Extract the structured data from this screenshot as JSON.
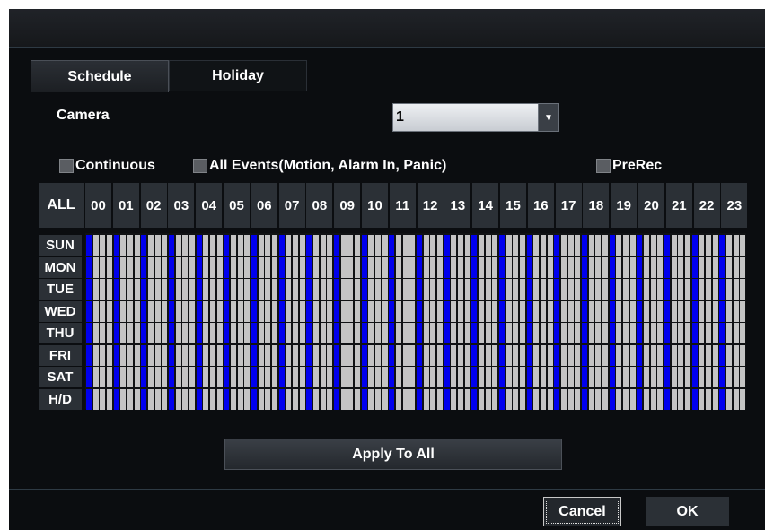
{
  "tabs": {
    "schedule": "Schedule",
    "holiday": "Holiday"
  },
  "camera": {
    "label": "Camera",
    "value": "1"
  },
  "checkboxes": {
    "continuous": "Continuous",
    "all_events": "All Events(Motion, Alarm In, Panic)",
    "prerec": "PreRec"
  },
  "grid": {
    "all_label": "ALL",
    "hours": [
      "00",
      "01",
      "02",
      "03",
      "04",
      "05",
      "06",
      "07",
      "08",
      "09",
      "10",
      "11",
      "12",
      "13",
      "14",
      "15",
      "16",
      "17",
      "18",
      "19",
      "20",
      "21",
      "22",
      "23"
    ],
    "days": [
      "SUN",
      "MON",
      "TUE",
      "WED",
      "THU",
      "FRI",
      "SAT",
      "H/D"
    ],
    "slot_pattern": [
      "event",
      "off",
      "off",
      "off"
    ],
    "colors": {
      "event": "#0000ee",
      "off": "#c4c4c4"
    }
  },
  "buttons": {
    "apply_all": "Apply To All",
    "cancel": "Cancel",
    "ok": "OK"
  }
}
